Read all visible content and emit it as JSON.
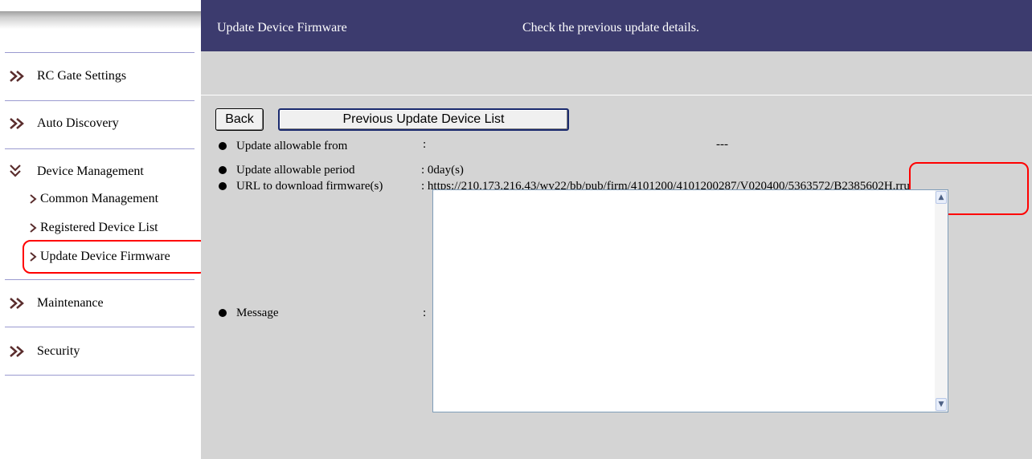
{
  "sidebar": {
    "items": [
      {
        "label": "RC Gate Settings",
        "icon": "double-chevron-right-icon"
      },
      {
        "label": "Auto Discovery",
        "icon": "double-chevron-right-icon"
      },
      {
        "label": "Device Management",
        "icon": "double-chevron-down-icon"
      },
      {
        "label": "Maintenance",
        "icon": "double-chevron-right-icon"
      },
      {
        "label": "Security",
        "icon": "double-chevron-right-icon"
      }
    ],
    "sub_items": [
      {
        "label": "Common Management",
        "icon": "chevron-right-icon"
      },
      {
        "label": "Registered Device List",
        "icon": "chevron-right-icon"
      },
      {
        "label": "Update Device Firmware",
        "icon": "chevron-right-icon",
        "highlighted": true
      }
    ],
    "icon_color": "#5a2d2d"
  },
  "header": {
    "title": "Update Device Firmware",
    "description": "Check the previous update details.",
    "background": "#3c3b6e"
  },
  "buttons": {
    "back": "Back",
    "previous_list": "Previous Update Device List"
  },
  "details": {
    "allowable_from": {
      "label": "Update allowable from",
      "colon": ":",
      "value": "---"
    },
    "allowable_period": {
      "label": "Update allowable period",
      "value": ": 0day(s)"
    },
    "url": {
      "label": "URL to download firmware(s)",
      "value": ": https://210.173.216.43/wv22/bb/pub/firm/4101200/4101200287/V020400/5363572/B2385602H.rru"
    },
    "message": {
      "label": "Message",
      "colon": ":",
      "value": ""
    }
  },
  "annotation_color": "#ff0000"
}
